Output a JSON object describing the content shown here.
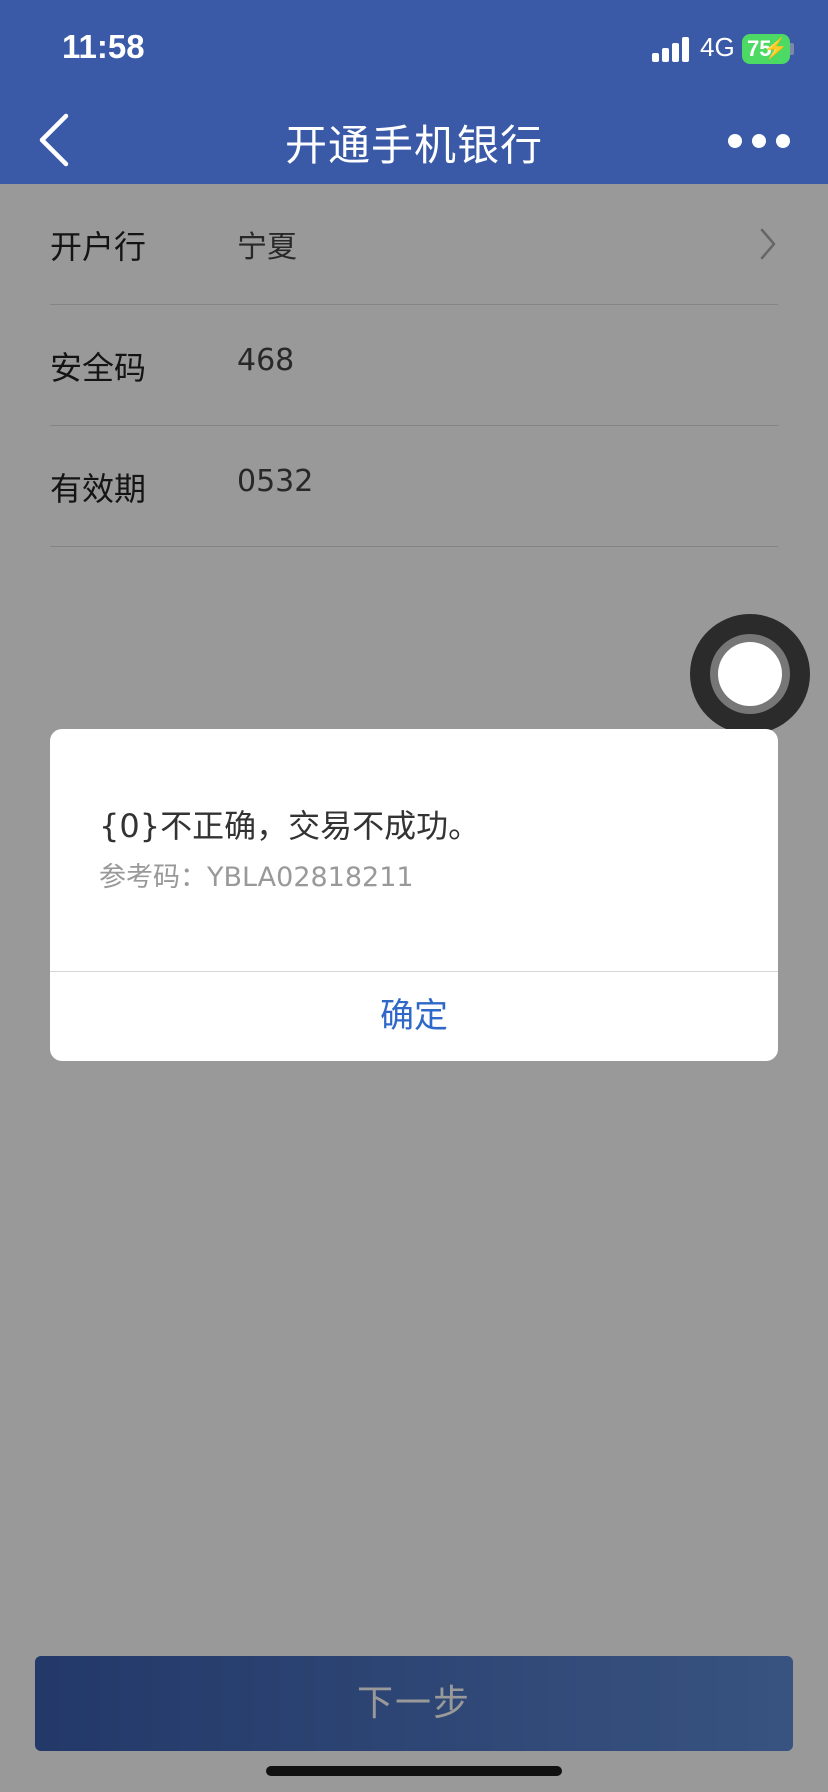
{
  "status_bar": {
    "time": "11:58",
    "network": "4G",
    "battery": "75"
  },
  "nav": {
    "title": "开通手机银行",
    "back_icon": "chevron-left-icon",
    "more_icon": "more-horizontal-icon"
  },
  "form": {
    "rows": [
      {
        "label": "开户行",
        "value": "宁夏",
        "has_chevron": true
      },
      {
        "label": "安全码",
        "value": "468"
      },
      {
        "label": "有效期",
        "value": "0532"
      }
    ]
  },
  "dialog": {
    "message": "{0}不正确，交易不成功。",
    "reference": "参考码：YBLA02818211",
    "confirm_label": "确定"
  },
  "footer": {
    "next_label": "下一步"
  },
  "colors": {
    "header": "#3a5aa8",
    "confirm_text": "#2f68c8",
    "battery": "#4cd964"
  }
}
